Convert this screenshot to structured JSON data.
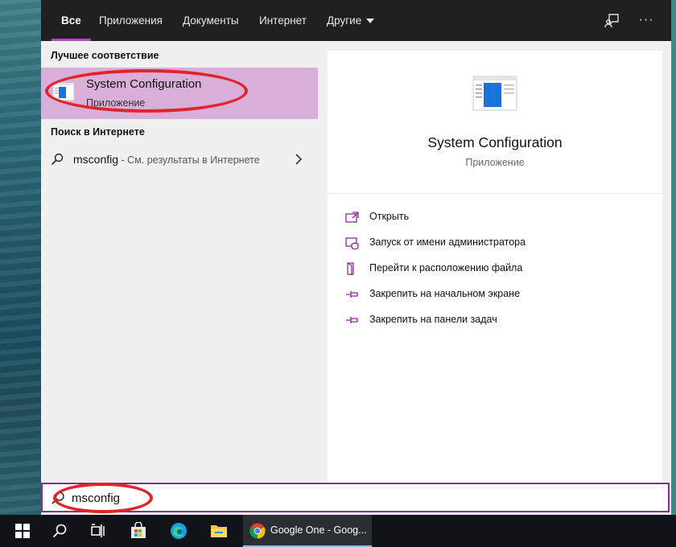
{
  "tabs": [
    {
      "label": "Все",
      "active": true
    },
    {
      "label": "Приложения"
    },
    {
      "label": "Документы"
    },
    {
      "label": "Интернет"
    },
    {
      "label": "Другие"
    }
  ],
  "toolbar_icons": [
    "feedback-icon",
    "more-options-icon"
  ],
  "more_glyph": "···",
  "best_match": {
    "section_title": "Лучшее соответствие",
    "name": "System Configuration",
    "kind": "Приложение"
  },
  "web_search": {
    "section_title": "Поиск в Интернете",
    "query": "msconfig",
    "suffix": " - См. результаты в Интернете"
  },
  "preview": {
    "title": "System Configuration",
    "kind": "Приложение",
    "actions": [
      {
        "label": "Открыть",
        "icon": "open-icon"
      },
      {
        "label": "Запуск от имени администратора",
        "icon": "run-as-admin-icon"
      },
      {
        "label": "Перейти к расположению файла",
        "icon": "file-location-icon"
      },
      {
        "label": "Закрепить на начальном экране",
        "icon": "pin-start-icon"
      },
      {
        "label": "Закрепить на панели задач",
        "icon": "pin-taskbar-icon"
      }
    ]
  },
  "search": {
    "value": "msconfig"
  },
  "taskbar": {
    "items": [
      "start-icon",
      "search-icon",
      "task-view-icon",
      "store-icon",
      "edge-icon",
      "file-explorer-icon"
    ],
    "active_app": "Google One - Goog..."
  },
  "colors": {
    "accent": "#b146c2",
    "highlight": "#d9aed8",
    "annotation": "#e0242b"
  }
}
